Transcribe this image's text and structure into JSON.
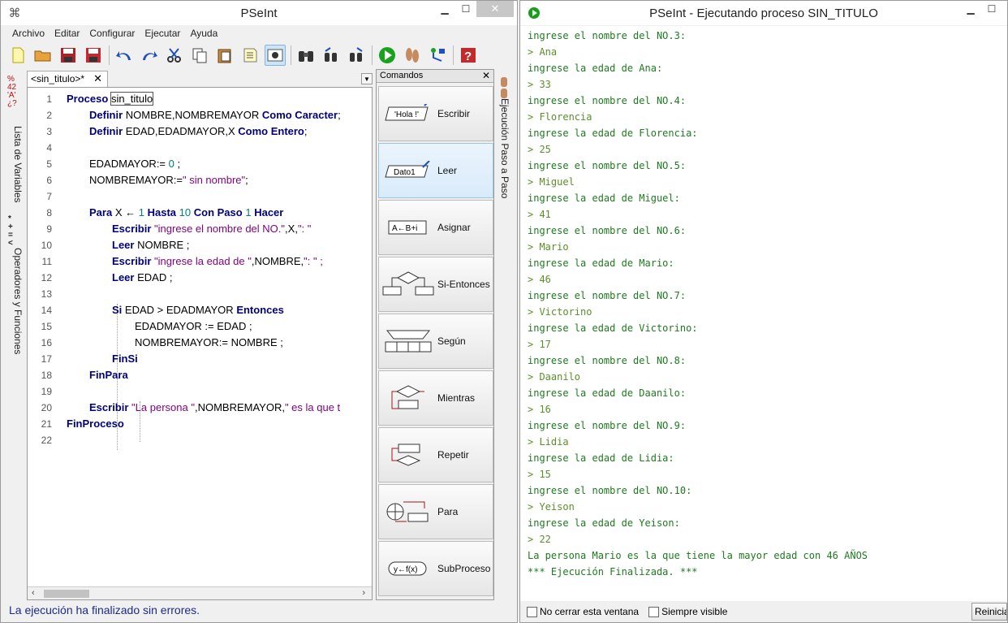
{
  "left_window": {
    "title": "PSeInt",
    "menu": [
      "Archivo",
      "Editar",
      "Configurar",
      "Ejecutar",
      "Ayuda"
    ],
    "side_tabs": {
      "variables": "Lista de Variables",
      "operators": "Operadores y Funciones",
      "step_run": "Ejecución Paso a Paso"
    },
    "editor_tab": "<sin_titulo>*",
    "code": [
      {
        "n": "1",
        "indent": 0
      },
      {
        "n": "2",
        "indent": 1
      },
      {
        "n": "3",
        "indent": 1
      },
      {
        "n": "4",
        "indent": 0
      },
      {
        "n": "5",
        "indent": 1
      },
      {
        "n": "6",
        "indent": 1
      },
      {
        "n": "7",
        "indent": 0
      },
      {
        "n": "8",
        "indent": 1
      },
      {
        "n": "9",
        "indent": 2
      },
      {
        "n": "10",
        "indent": 2
      },
      {
        "n": "11",
        "indent": 2
      },
      {
        "n": "12",
        "indent": 2
      },
      {
        "n": "13",
        "indent": 0
      },
      {
        "n": "14",
        "indent": 2
      },
      {
        "n": "15",
        "indent": 3
      },
      {
        "n": "16",
        "indent": 3
      },
      {
        "n": "17",
        "indent": 2
      },
      {
        "n": "18",
        "indent": 1
      },
      {
        "n": "19",
        "indent": 0
      },
      {
        "n": "20",
        "indent": 1
      },
      {
        "n": "21",
        "indent": 0
      },
      {
        "n": "22",
        "indent": 0
      }
    ],
    "code_tokens": {
      "l1": {
        "kw": "Proceso",
        "name": "sin_titulo"
      },
      "l2": {
        "kw1": "Definir",
        "ids": "NOMBRE,NOMBREMAYOR",
        "kw2": "Como Caracter",
        "end": ";"
      },
      "l3": {
        "kw1": "Definir",
        "ids": "EDAD,EDADMAYOR,X",
        "kw2": "Como Entero",
        "end": ";"
      },
      "l5": {
        "id": "EDADMAYOR:=",
        "num": "0",
        "end": ";"
      },
      "l6": {
        "id": "NOMBREMAYOR:=",
        "str": "\" sin nombre\"",
        "end": ";"
      },
      "l8": {
        "kw1": "Para",
        "id": "X",
        "arrow": "←",
        "n1": "1",
        "kw2": "Hasta",
        "n2": "10",
        "kw3": "Con Paso",
        "n3": "1",
        "kw4": "Hacer"
      },
      "l9": {
        "kw": "Escribir",
        "str1": "\"ingrese el nombre del NO.\"",
        "mid": ",X,",
        "str2": "\": \""
      },
      "l10": {
        "kw": "Leer",
        "rest": "NOMBRE ;"
      },
      "l11": {
        "kw": "Escribir",
        "str1": "\"ingrese la edad de \"",
        "mid": ",NOMBRE,",
        "str2": "\": \" ;"
      },
      "l12": {
        "kw": "Leer",
        "rest": "EDAD ;"
      },
      "l14": {
        "kw1": "Si",
        "rest": "EDAD > EDADMAYOR",
        "kw2": "Entonces"
      },
      "l15": {
        "rest": "EDADMAYOR := EDAD ;"
      },
      "l16": {
        "rest": "NOMBREMAYOR:= NOMBRE ;"
      },
      "l17": {
        "kw": "FinSi"
      },
      "l18": {
        "kw": "FinPara"
      },
      "l20": {
        "kw": "Escribir",
        "str1": "\"La persona \"",
        "mid": ",NOMBREMAYOR,",
        "str2": "\" es la que t"
      },
      "l21": {
        "kw": "FinProceso"
      }
    },
    "commands": {
      "title": "Comandos",
      "items": [
        {
          "label": "Escribir",
          "icon_text": "'Hola !'"
        },
        {
          "label": "Leer",
          "icon_text": "Dato1"
        },
        {
          "label": "Asignar",
          "icon_text": "A←B+i"
        },
        {
          "label": "Si-Entonces",
          "icon_text": ""
        },
        {
          "label": "Según",
          "icon_text": ""
        },
        {
          "label": "Mientras",
          "icon_text": ""
        },
        {
          "label": "Repetir",
          "icon_text": ""
        },
        {
          "label": "Para",
          "icon_text": ""
        },
        {
          "label": "SubProceso",
          "icon_text": "y←f(x)"
        }
      ]
    },
    "status": "La ejecución ha finalizado sin errores."
  },
  "right_window": {
    "title": "PSeInt - Ejecutando proceso SIN_TITULO",
    "console": [
      {
        "t": "ingrese el nombre del NO.3:",
        "k": "out"
      },
      {
        "t": "> Ana",
        "k": "in"
      },
      {
        "t": "ingrese la edad de Ana:",
        "k": "out"
      },
      {
        "t": "> 33",
        "k": "in"
      },
      {
        "t": "ingrese el nombre del NO.4:",
        "k": "out"
      },
      {
        "t": "> Florencia",
        "k": "in"
      },
      {
        "t": "ingrese la edad de Florencia:",
        "k": "out"
      },
      {
        "t": "> 25",
        "k": "in"
      },
      {
        "t": "ingrese el nombre del NO.5:",
        "k": "out"
      },
      {
        "t": "> Miguel",
        "k": "in"
      },
      {
        "t": "ingrese la edad de Miguel:",
        "k": "out"
      },
      {
        "t": "> 41",
        "k": "in"
      },
      {
        "t": "ingrese el nombre del NO.6:",
        "k": "out"
      },
      {
        "t": "> Mario",
        "k": "in"
      },
      {
        "t": "ingrese la edad de Mario:",
        "k": "out"
      },
      {
        "t": "> 46",
        "k": "in"
      },
      {
        "t": "ingrese el nombre del NO.7:",
        "k": "out"
      },
      {
        "t": "> Victorino",
        "k": "in"
      },
      {
        "t": "ingrese la edad de Victorino:",
        "k": "out"
      },
      {
        "t": "> 17",
        "k": "in"
      },
      {
        "t": "ingrese el nombre del NO.8:",
        "k": "out"
      },
      {
        "t": "> Daanilo",
        "k": "in"
      },
      {
        "t": "ingrese la edad de Daanilo:",
        "k": "out"
      },
      {
        "t": "> 16",
        "k": "in"
      },
      {
        "t": "ingrese el nombre del NO.9:",
        "k": "out"
      },
      {
        "t": "> Lidia",
        "k": "in"
      },
      {
        "t": "ingrese la edad de Lidia:",
        "k": "out"
      },
      {
        "t": "> 15",
        "k": "in"
      },
      {
        "t": "ingrese el nombre del NO.10:",
        "k": "out"
      },
      {
        "t": "> Yeison",
        "k": "in"
      },
      {
        "t": "ingrese la edad de Yeison:",
        "k": "out"
      },
      {
        "t": "> 22",
        "k": "in"
      },
      {
        "t": "La persona Mario es la que tiene la mayor edad con 46 AÑOS",
        "k": "out"
      },
      {
        "t": "*** Ejecución Finalizada. ***",
        "k": "fin"
      }
    ],
    "no_close_label": "No cerrar esta ventana",
    "always_visible_label": "Siempre visible",
    "restart_label": "Reiniciar"
  },
  "colors": {
    "keyword": "#00007f",
    "string": "#7f007f",
    "number": "#007f7f",
    "console_text": "#1e7a1e",
    "status_text": "#1c2b8c"
  }
}
